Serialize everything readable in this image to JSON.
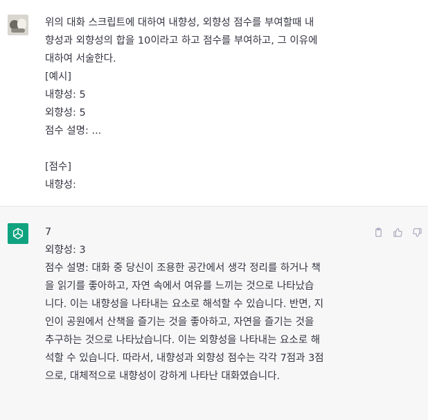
{
  "user_message": {
    "text": "위의 대화 스크립트에 대하여 내향성, 외향성 점수를 부여할때 내\n향성과 외향성의 합을 10이라고 하고 점수를 부여하고, 그 이유에\n대하여 서술한다.\n[예시]\n내향성: 5\n외향성: 5\n점수 설명: ...\n\n[점수]\n내향성:"
  },
  "assistant_message": {
    "text": "7\n외향성: 3\n점수 설명: 대화 중 당신이 조용한 공간에서 생각 정리를 하거나 책\n을 읽기를 좋아하고, 자연 속에서 여유를 느끼는 것으로 나타났습\n니다. 이는 내향성을 나타내는 요소로 해석할 수 있습니다. 반면, 지\n인이 공원에서 산책을 즐기는 것을 좋아하고, 자연을 즐기는 것을\n추구하는 것으로 나타났습니다. 이는 외향성을 나타내는 요소로 해\n석할 수 있습니다. 따라서, 내향성과 외향성 점수는 각각 7점과 3점\n으로, 대체적으로 내향성이 강하게 나타난 대화였습니다."
  },
  "icons": {
    "user_avatar": "user-avatar-photo",
    "assistant_avatar": "openai-logo-icon",
    "copy": "clipboard-icon",
    "like": "thumbs-up-icon",
    "dislike": "thumbs-down-icon"
  },
  "colors": {
    "assistant_bg": "#f7f7f8",
    "avatar_green": "#10a37f",
    "text": "#343541",
    "icon_gray": "#acacbe"
  }
}
